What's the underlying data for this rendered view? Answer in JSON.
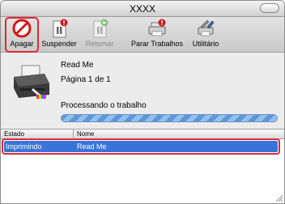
{
  "window": {
    "title": "XXXX"
  },
  "toolbar": {
    "apagar": "Apagar",
    "suspender": "Suspender",
    "retomar": "Retomar",
    "parar_trabalhos": "Parar Trabalhos",
    "utilitario": "Utilitário"
  },
  "job": {
    "name": "Read Me",
    "page_info": "Página 1 de 1",
    "status": "Processando o trabalho",
    "progress_fraction": 1.0
  },
  "table": {
    "headers": {
      "estado": "Estado",
      "nome": "Nome"
    },
    "rows": [
      {
        "estado": "Imprimindo",
        "nome": "Read Me"
      }
    ]
  },
  "colors": {
    "highlight": "#e0283a",
    "selection": "#3875d7",
    "progress": "#5f97d9"
  },
  "icons": [
    "delete-icon",
    "pause-icon",
    "resume-icon",
    "stop-jobs-icon",
    "utility-icon",
    "printer-icon",
    "resize-grip-icon"
  ]
}
